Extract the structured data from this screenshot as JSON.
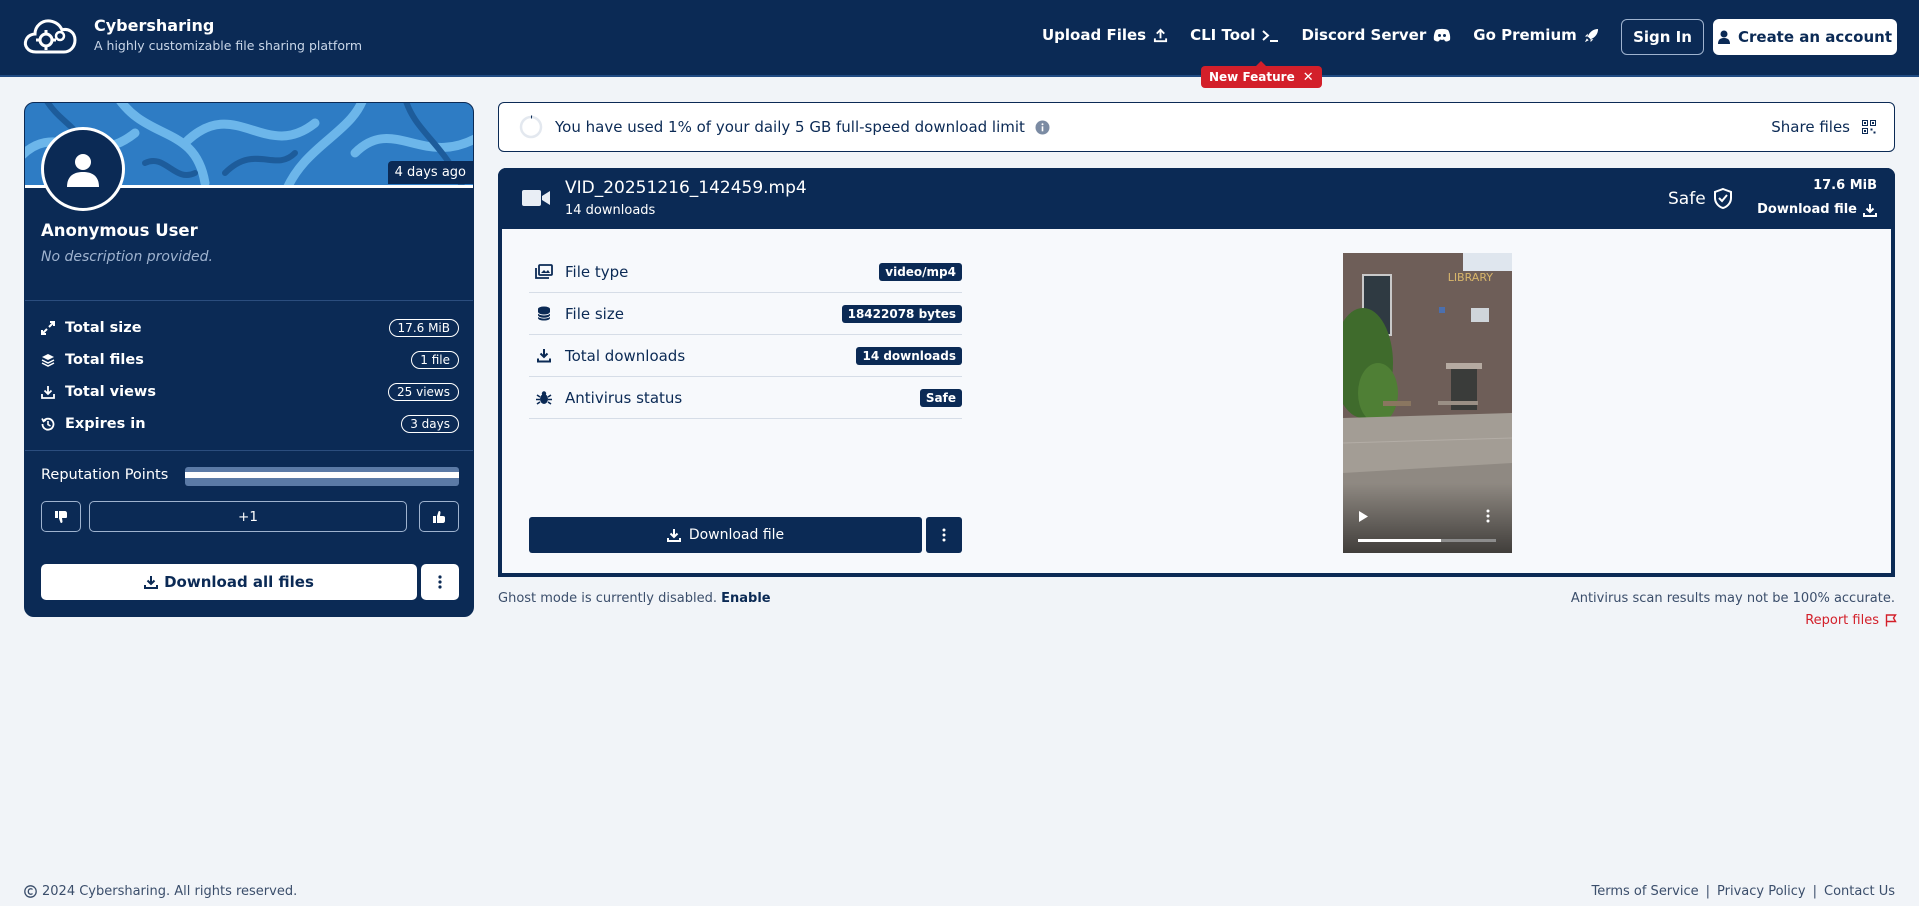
{
  "brand": {
    "name": "Cybersharing",
    "tagline": "A highly customizable file sharing platform"
  },
  "nav": {
    "items": [
      {
        "label": "Upload Files",
        "icon": "upload-icon"
      },
      {
        "label": "CLI Tool",
        "icon": "terminal-icon"
      },
      {
        "label": "Discord Server",
        "icon": "discord-icon"
      },
      {
        "label": "Go Premium",
        "icon": "rocket-icon"
      }
    ],
    "sign_in": "Sign In",
    "create_account": "Create an account",
    "new_feature": "New Feature"
  },
  "profile": {
    "time_ago": "4 days ago",
    "name": "Anonymous User",
    "description": "No description provided.",
    "stats": [
      {
        "label": "Total size",
        "value": "17.6 MiB",
        "icon": "expand-icon"
      },
      {
        "label": "Total files",
        "value": "1 file",
        "icon": "layers-icon"
      },
      {
        "label": "Total views",
        "value": "25 views",
        "icon": "download-icon"
      },
      {
        "label": "Expires in",
        "value": "3 days",
        "icon": "history-icon"
      }
    ],
    "reputation_label": "Reputation Points",
    "reputation_score": "+1",
    "download_all": "Download all files"
  },
  "quota": {
    "text": "You have used 1% of your daily 5 GB full-speed download limit",
    "share_label": "Share files"
  },
  "file": {
    "name": "VID_20251216_142459.mp4",
    "downloads_line": "14 downloads",
    "safe_label": "Safe",
    "size": "17.6 MiB",
    "download_label": "Download file",
    "meta": [
      {
        "label": "File type",
        "value": "video/mp4",
        "icon": "images-icon"
      },
      {
        "label": "File size",
        "value": "18422078 bytes",
        "icon": "database-icon"
      },
      {
        "label": "Total downloads",
        "value": "14 downloads",
        "icon": "download-icon"
      },
      {
        "label": "Antivirus status",
        "value": "Safe",
        "icon": "bug-icon"
      }
    ],
    "download_button": "Download file",
    "video_sign_text": "LIBRARY"
  },
  "notes": {
    "ghost_text": "Ghost mode is currently disabled.",
    "ghost_link": "Enable",
    "antivirus_note": "Antivirus scan results may not be 100% accurate.",
    "report": "Report files"
  },
  "footer": {
    "copyright": "2024 Cybersharing. All rights reserved.",
    "links": [
      "Terms of Service",
      "Privacy Policy",
      "Contact Us"
    ]
  }
}
